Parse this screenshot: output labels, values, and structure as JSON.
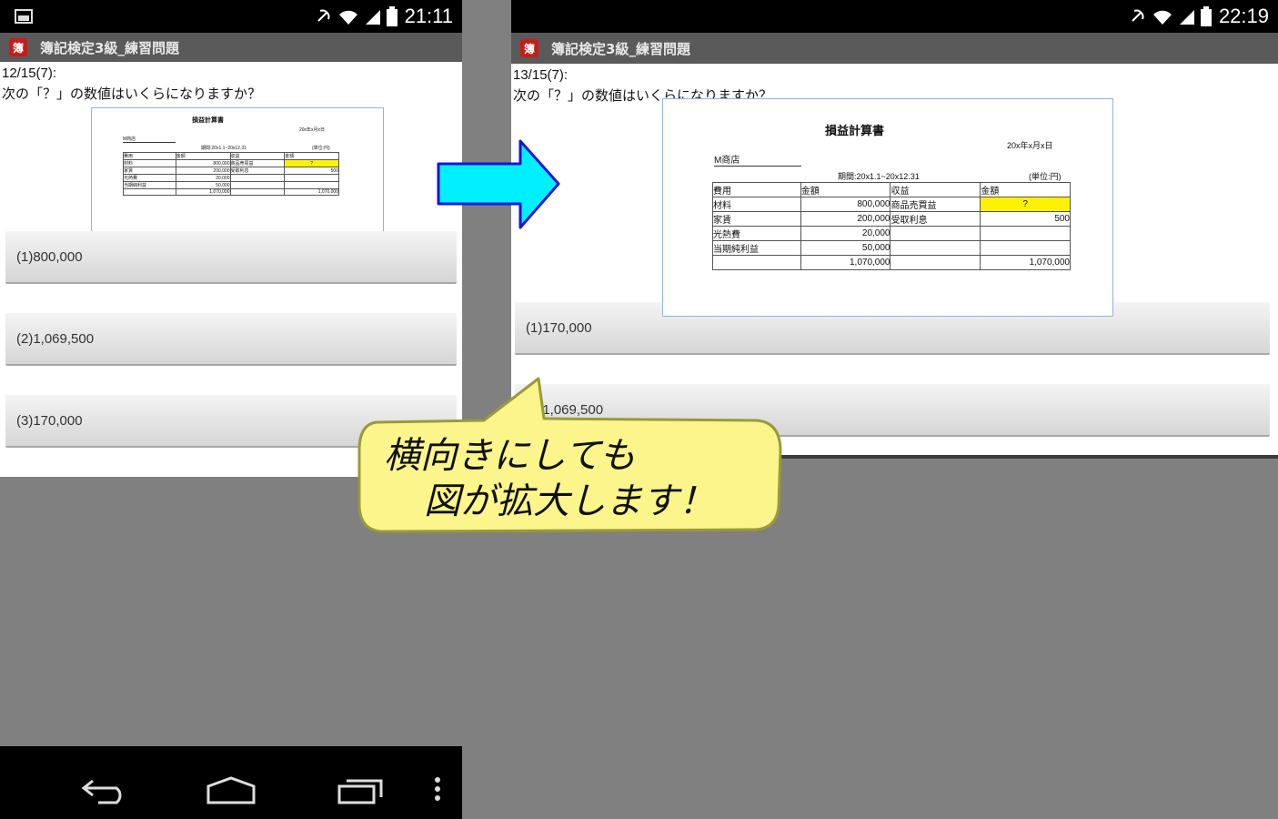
{
  "left_phone": {
    "status_time": "21:11",
    "app_title": "簿記検定3級_練習問題",
    "question_number": "12/15(7):",
    "question_text": "次の「？」の数値はいくらになりますか？",
    "answers": [
      "(1)800,000",
      "(2)1,069,500",
      "(3)170,000"
    ]
  },
  "right_phone": {
    "status_time": "22:19",
    "app_title": "簿記検定3級_練習問題",
    "question_number": "13/15(7):",
    "question_text": "次の「？」の数値はいくらになりますか？",
    "answers": [
      "(1)170,000",
      "(2)1,069,500"
    ]
  },
  "statement": {
    "title": "損益計算書",
    "store": "M商店",
    "date": "20x年x月x日",
    "period": "期間:20x1.1~20x12.31",
    "unit": "(単位:円)",
    "headers": [
      "費用",
      "金額",
      "収益",
      "金額"
    ],
    "rows": [
      [
        "材料",
        "800,000",
        "商品売買益",
        "?"
      ],
      [
        "家賃",
        "200,000",
        "受取利息",
        "500"
      ],
      [
        "光熱費",
        "20,000",
        "",
        ""
      ],
      [
        "当期純利益",
        "50,000",
        "",
        ""
      ],
      [
        "",
        "1,070,000",
        "",
        "1,070,000"
      ]
    ]
  },
  "callout": {
    "line1": "横向きにしても",
    "line2": "図が拡大します！"
  },
  "colors": {
    "arrow_fill": "#00f0ff",
    "arrow_stroke": "#1515d8",
    "callout_fill": "#fbf58c",
    "callout_stroke": "#9a9a3a",
    "highlight": "#fff200"
  }
}
